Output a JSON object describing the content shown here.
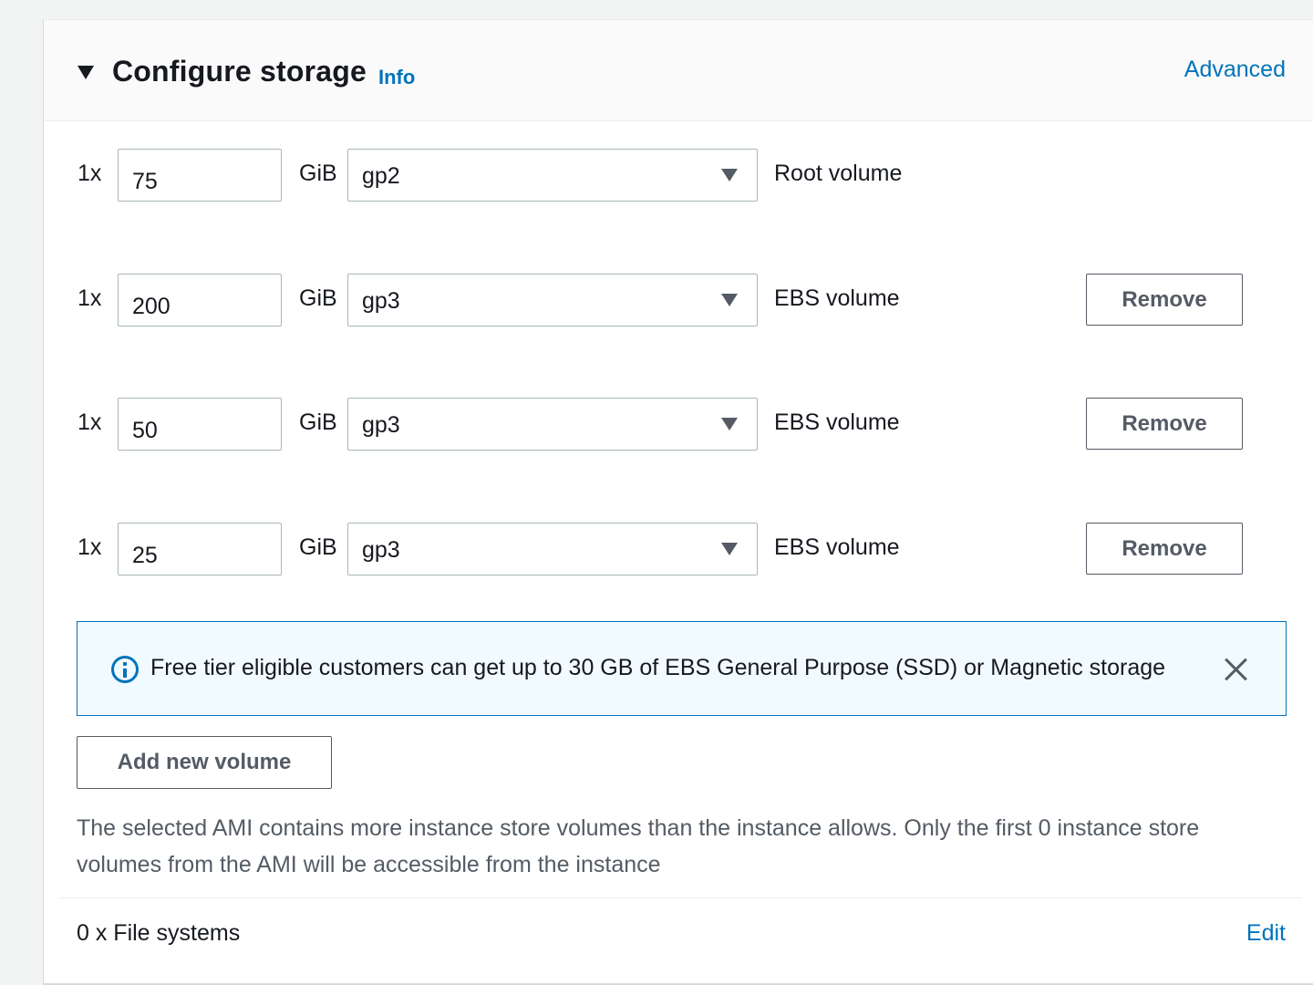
{
  "header": {
    "title": "Configure storage",
    "info_label": "Info",
    "advanced_label": "Advanced"
  },
  "volumes": [
    {
      "multiplier": "1x",
      "size": "75",
      "unit": "GiB",
      "type": "gp2",
      "label": "Root volume",
      "remove_label": ""
    },
    {
      "multiplier": "1x",
      "size": "200",
      "unit": "GiB",
      "type": "gp3",
      "label": "EBS volume",
      "remove_label": "Remove"
    },
    {
      "multiplier": "1x",
      "size": "50",
      "unit": "GiB",
      "type": "gp3",
      "label": "EBS volume",
      "remove_label": "Remove"
    },
    {
      "multiplier": "1x",
      "size": "25",
      "unit": "GiB",
      "type": "gp3",
      "label": "EBS volume",
      "remove_label": "Remove"
    }
  ],
  "alert": {
    "icon": "info-circle-icon",
    "text": "Free tier eligible customers can get up to 30 GB of EBS General Purpose (SSD) or Magnetic storage"
  },
  "add_volume_label": "Add new volume",
  "note": "The selected AMI contains more instance store volumes than the instance allows. Only the first 0 instance store volumes from the AMI will be accessible from the instance",
  "file_systems": {
    "label": "0 x File systems",
    "edit_label": "Edit"
  },
  "colors": {
    "link": "#0073bb",
    "alert_bg": "#f1faff",
    "border": "#aab7b8",
    "button_text": "#545b64"
  }
}
